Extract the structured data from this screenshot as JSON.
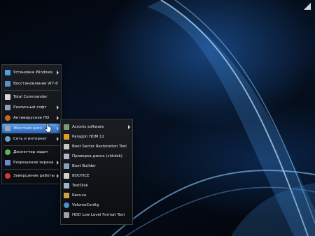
{
  "colors": {
    "accent": "#2a64b8",
    "menu_bg": "#0b0d10",
    "text": "#e8ecf2"
  },
  "main_menu": {
    "items": [
      {
        "label": "Установка Windows",
        "icon": "windows-setup-icon",
        "color": "#4aa0e0"
      },
      {
        "label": "Восстановление W7-8",
        "icon": "windows-restore-icon",
        "color": "#5a8fd0"
      },
      {
        "label": "Total Commander",
        "icon": "total-commander-icon",
        "color": "#d8d8d8"
      },
      {
        "label": "Различный софт",
        "icon": "software-icon",
        "color": "#8aa0c0"
      },
      {
        "label": "Антивирусное ПО",
        "icon": "antivirus-icon",
        "color": "#c06a30"
      },
      {
        "label": "Жесткий диск",
        "icon": "hard-disk-icon",
        "color": "#9aa8b8"
      },
      {
        "label": "Сеть и интернет",
        "icon": "network-icon",
        "color": "#6aa0d0"
      },
      {
        "label": "Диспетчер задач",
        "icon": "task-manager-icon",
        "color": "#60b060"
      },
      {
        "label": "Разрешение экрана",
        "icon": "screen-resolution-icon",
        "color": "#6a8ad0"
      },
      {
        "label": "Завершение работы",
        "icon": "shutdown-icon",
        "color": "#d03a3a"
      }
    ]
  },
  "sub_menu": {
    "items": [
      {
        "label": "Acronis software",
        "icon": "acronis-icon",
        "color": "#7a9a7a"
      },
      {
        "label": "Paragon HDM 12",
        "icon": "paragon-icon",
        "color": "#e0a020"
      },
      {
        "label": "Boot Sector Restoration Tool",
        "icon": "boot-sector-icon",
        "color": "#c8c8c8"
      },
      {
        "label": "Проверка диска (chkdsk)",
        "icon": "chkdsk-icon",
        "color": "#b0b8c4"
      },
      {
        "label": "Boot Builder",
        "icon": "boot-builder-icon",
        "color": "#8aa0b8"
      },
      {
        "label": "BOOTICE",
        "icon": "bootice-icon",
        "color": "#d0d0d0"
      },
      {
        "label": "TestDisk",
        "icon": "testdisk-icon",
        "color": "#a0b4c8"
      },
      {
        "label": "Recuva",
        "icon": "recuva-icon",
        "color": "#d0a040"
      },
      {
        "label": "VolumeConfig",
        "icon": "volumeconfig-icon",
        "color": "#4a90d0"
      },
      {
        "label": "HDD Low Level Format Tool",
        "icon": "hdd-format-icon",
        "color": "#9aa4b0"
      }
    ]
  }
}
